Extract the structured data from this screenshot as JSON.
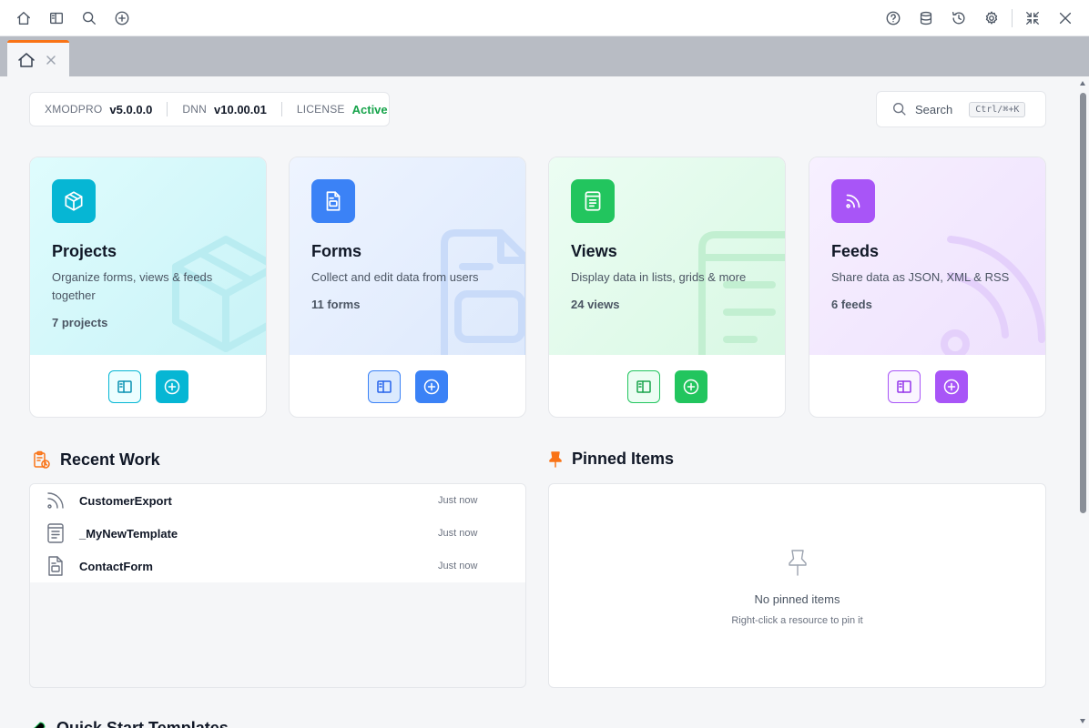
{
  "toolbar": {
    "left_icons": [
      "home-icon",
      "sidebar-icon",
      "search-icon",
      "add-circle-icon"
    ],
    "right_icons": [
      "help-icon",
      "database-icon",
      "history-icon",
      "settings-icon",
      "collapse-icon",
      "close-icon"
    ]
  },
  "tab": {
    "icon": "home-icon",
    "close_icon": "close-icon",
    "accent": "#f97316"
  },
  "version": {
    "product_key": "XMODPRO",
    "product_value": "v5.0.0.0",
    "dnn_key": "DNN",
    "dnn_value": "v10.00.01",
    "license_key": "LICENSE",
    "license_value": "Active"
  },
  "search": {
    "label": "Search",
    "shortcut": "Ctrl/⌘+K"
  },
  "cards": [
    {
      "title": "Projects",
      "description": "Organize forms, views & feeds together",
      "count": "7 projects",
      "color": "#06b6d4",
      "icon": "cube-icon"
    },
    {
      "title": "Forms",
      "description": "Collect and edit data from users",
      "count": "11 forms",
      "color": "#3b82f6",
      "icon": "form-icon"
    },
    {
      "title": "Views",
      "description": "Display data in lists, grids & more",
      "count": "24 views",
      "color": "#22c55e",
      "icon": "list-icon"
    },
    {
      "title": "Feeds",
      "description": "Share data as JSON, XML & RSS",
      "count": "6 feeds",
      "color": "#a855f7",
      "icon": "rss-icon"
    }
  ],
  "recent": {
    "title": "Recent Work",
    "items": [
      {
        "name": "CustomerExport",
        "time": "Just now",
        "icon": "rss-icon"
      },
      {
        "name": "_MyNewTemplate",
        "time": "Just now",
        "icon": "list-icon"
      },
      {
        "name": "ContactForm",
        "time": "Just now",
        "icon": "form-icon"
      }
    ]
  },
  "pinned": {
    "title": "Pinned Items",
    "empty_title": "No pinned items",
    "empty_hint": "Right-click a resource to pin it"
  },
  "quickstart": {
    "title": "Quick Start Templates"
  }
}
